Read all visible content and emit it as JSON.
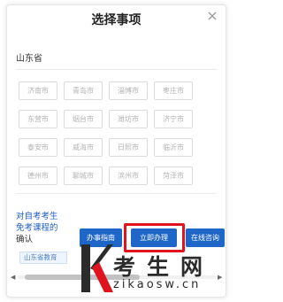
{
  "dialog": {
    "title": "选择事项",
    "close_icon": "close-icon",
    "province": "山东省"
  },
  "cities": [
    "济南市",
    "青岛市",
    "淄博市",
    "枣庄市",
    "东营市",
    "烟台市",
    "潍坊市",
    "济宁市",
    "泰安市",
    "威海市",
    "日照市",
    "临沂市",
    "德州市",
    "聊城市",
    "滨州市",
    "菏泽市"
  ],
  "notice": {
    "line1": "对自考考生",
    "line2": "免考课程的",
    "line3": "确认",
    "tag": "山东省教育"
  },
  "buttons": {
    "guide": "办事指南",
    "now": "立即办理",
    "consult": "在线咨询"
  },
  "watermark": {
    "big": "考生网",
    "url": "zikaosw.cn"
  },
  "colors": {
    "accent": "#1f66c9",
    "highlight": "#e0141e"
  }
}
